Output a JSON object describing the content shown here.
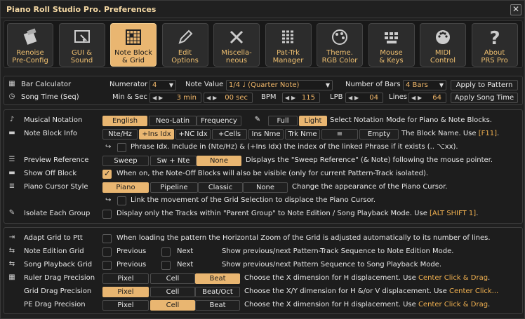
{
  "window": {
    "title": "Piano Roll Studio Pro.  Preferences",
    "close": "✕"
  },
  "toolbar": [
    {
      "name": "Renoise Pre-Config",
      "l1": "Renoise",
      "l2": "Pre-Config",
      "icon": "renoise-icon"
    },
    {
      "name": "GUI & Sound",
      "l1": "GUI &",
      "l2": "Sound",
      "icon": "gui-sound-icon"
    },
    {
      "name": "Note Block & Grid",
      "l1": "Note Block",
      "l2": "& Grid",
      "icon": "grid-icon",
      "active": true
    },
    {
      "name": "Edit Options",
      "l1": "Edit",
      "l2": "Options",
      "icon": "pencil-icon"
    },
    {
      "name": "Miscellaneous",
      "l1": "Miscella-",
      "l2": "neous",
      "icon": "tools-icon"
    },
    {
      "name": "Pat-Trk Manager",
      "l1": "Pat-Trk",
      "l2": "Manager",
      "icon": "manager-icon"
    },
    {
      "name": "Theme. RGB Color",
      "l1": "Theme.",
      "l2": "RGB Color",
      "icon": "palette-icon"
    },
    {
      "name": "Mouse & Keys",
      "l1": "Mouse",
      "l2": "& Keys",
      "icon": "keys-icon"
    },
    {
      "name": "MIDI Control",
      "l1": "MIDI",
      "l2": "Control",
      "icon": "midi-icon"
    },
    {
      "name": "About PRS Pro",
      "l1": "About",
      "l2": "PRS Pro",
      "icon": "question-icon"
    }
  ],
  "calc": {
    "bar_calculator": "Bar Calculator",
    "numerator_label": "Numerator",
    "numerator": "4",
    "note_value_label": "Note Value",
    "note_value": "1/4  ♩ (Quarter Note)",
    "bars_label": "Number of Bars",
    "bars": "4 Bars",
    "apply_pattern": "Apply to Pattern",
    "song_time": "Song Time (Seq)",
    "minsec_label": "Min & Sec",
    "min": "3 min",
    "sec": "00 sec",
    "bpm_label": "BPM",
    "bpm": "115",
    "lpb_label": "LPB",
    "lpb": "04",
    "lines_label": "Lines",
    "lines": "64",
    "apply_song": "Apply Song Time"
  },
  "notation": {
    "label": "Musical Notation",
    "english": "English",
    "neolatin": "Neo-Latin",
    "frequency": "Frequency",
    "full": "Full",
    "light": "Light",
    "desc": "Select Notation Mode for Piano & Note Blocks."
  },
  "noteblock": {
    "label": "Note Block Info",
    "b1": "Nte/Hz",
    "b2": "+Ins Idx",
    "b3": "+NC Idx",
    "b4": "+Cells",
    "b5": "Ins Nme",
    "b6": "Trk Nme",
    "b7": "≡",
    "b8": "Empty",
    "desc": "The Block Name. Use ",
    "key": "[F11]",
    "dot": ".",
    "phrase": "Phrase Idx. Include in (Nte/Hz) & (+Ins Idx) the index of the linked Phrase if it exists (.. ⌥xx)."
  },
  "preview": {
    "label": "Preview Reference",
    "sweep": "Sweep",
    "swnte": "Sw + Nte",
    "none": "None",
    "desc": "Displays the \"Sweep Reference\" (& Note) following the mouse pointer."
  },
  "showoff": {
    "label": "Show Off Block",
    "desc": "When on, the Note-Off Blocks will also be visible (only for current Pattern-Track isolated)."
  },
  "cursor": {
    "label": "Piano Cursor Style",
    "piano": "Piano",
    "pipeline": "Pipeline",
    "classic": "Classic",
    "none": "None",
    "desc": "Change the appearance of the Piano Cursor.",
    "link": "Link the movement of the Grid Selection to displace the Piano Cursor."
  },
  "isolate": {
    "label": "Isolate Each Group",
    "desc": "Display only the Tracks within \"Parent Group\" to Note Edition / Song Playback Mode. Use ",
    "key": "[ALT SHIFT 1]",
    "dot": "."
  },
  "adapt": {
    "label": "Adapt Grid to Ptt",
    "desc": "When loading the pattern the Horizontal Zoom of the Grid is adjusted automatically to its number of lines."
  },
  "noteedit": {
    "label": "Note Edition Grid",
    "prev": "Previous",
    "next": "Next",
    "desc": "Show previous/next Pattern-Track Sequence to Note Edition Mode."
  },
  "songplay": {
    "label": "Song Playback Grid",
    "prev": "Previous",
    "next": "Next",
    "desc": "Show previous/next Pattern Sequence to Song Playback Mode."
  },
  "ruler": {
    "label": "Ruler Drag Precision",
    "pixel": "Pixel",
    "cell": "Cell",
    "beat": "Beat",
    "desc": "Choose the X dimension for H displacement. Use ",
    "key": "Center Click & Drag",
    "dot": "."
  },
  "griddrag": {
    "label": "Grid Drag Precision",
    "pixel": "Pixel",
    "cell": "Cell",
    "beat": "Beat/Oct",
    "desc": "Choose the X/Y dimension for H &/or V displacement. Use ",
    "key": "Center Click..."
  },
  "pedrag": {
    "label": "PE Drag Precision",
    "pixel": "Pixel",
    "cell": "Cell",
    "beat": "Beat",
    "desc": "Choose the X dimension for H displacement. Use ",
    "key": "Center Click & Drag",
    "dot": "."
  }
}
